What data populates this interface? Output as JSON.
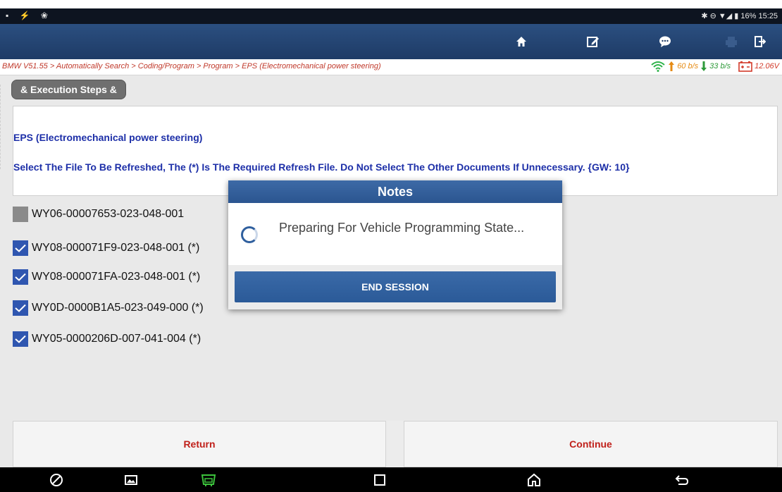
{
  "status_bar": {
    "left_glyphs": "▪ ⚡ ❀",
    "right": "✱ ⊖ ▼◢ ▮ 16%  15:25"
  },
  "toolbar": {
    "buttons": [
      {
        "icon": "home-icon"
      },
      {
        "icon": "edit-icon"
      },
      {
        "icon": "chat-icon"
      },
      {
        "icon": "print-icon"
      },
      {
        "icon": "exit-icon"
      }
    ]
  },
  "breadcrumb": "BMW V51.55 > Automatically Search > Coding/Program > Program > EPS (Electromechanical power steering)",
  "netstats": {
    "upload": "60 b/s",
    "download": "33 b/s",
    "voltage": "12.06V"
  },
  "steps_label": "& Execution Steps &",
  "info": {
    "title": "EPS (Electromechanical power steering)",
    "instruction": "Select The File To Be Refreshed, The (*) Is The Required Refresh File. Do Not Select The Other Documents If Unnecessary.     {GW: 10}"
  },
  "files": [
    {
      "label": "WY06-00007653-023-048-001",
      "checked": false
    },
    {
      "label": "WY08-000071F9-023-048-001  (*)",
      "checked": true
    },
    {
      "label": "WY08-000071FA-023-048-001  (*)",
      "checked": true
    },
    {
      "label": "WY0D-0000B1A5-023-049-000  (*)",
      "checked": true
    },
    {
      "label": "WY05-0000206D-007-041-004  (*)",
      "checked": true
    }
  ],
  "buttons": {
    "return": "Return",
    "continue": "Continue"
  },
  "modal": {
    "title": "Notes",
    "message": "Preparing For Vehicle Programming State...",
    "action": "END SESSION"
  },
  "colors": {
    "toolbar": "#1e3b66",
    "link_red": "#c0392b",
    "info_blue": "#1d2fa8",
    "checkbox_blue": "#2f56b0"
  }
}
